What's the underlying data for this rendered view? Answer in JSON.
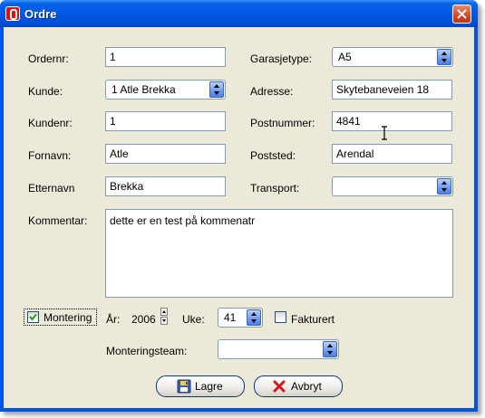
{
  "window": {
    "title": "Ordre",
    "close_label": "close"
  },
  "form": {
    "ordernr": {
      "label": "Ordernr:",
      "value": "1"
    },
    "kunde": {
      "label": "Kunde:",
      "value": "1 Atle Brekka"
    },
    "kundenr": {
      "label": "Kundenr:",
      "value": "1"
    },
    "fornavn": {
      "label": "Fornavn:",
      "value": "Atle"
    },
    "etternavn": {
      "label": "Etternavn",
      "value": "Brekka"
    },
    "garasjetype": {
      "label": "Garasjetype:",
      "value": "A5"
    },
    "adresse": {
      "label": "Adresse:",
      "value": "Skytebaneveien 18"
    },
    "postnummer": {
      "label": "Postnummer:",
      "value": "4841"
    },
    "poststed": {
      "label": "Poststed:",
      "value": "Arendal"
    },
    "transport": {
      "label": "Transport:",
      "value": ""
    },
    "kommentar": {
      "label": "Kommentar:",
      "value": "dette er en test på kommenatr"
    },
    "montering": {
      "label": "Montering",
      "checked": true
    },
    "aar": {
      "label": "År:",
      "value": "2006"
    },
    "uke": {
      "label": "Uke:",
      "value": "41"
    },
    "fakturert": {
      "label": "Fakturert",
      "checked": false
    },
    "monteringsteam": {
      "label": "Monteringsteam:",
      "value": ""
    }
  },
  "buttons": {
    "lagre": "Lagre",
    "avbryt": "Avbryt"
  },
  "icons": {
    "app": "app-logo-icon",
    "save": "floppy-disk-icon",
    "cancel": "red-x-icon"
  }
}
